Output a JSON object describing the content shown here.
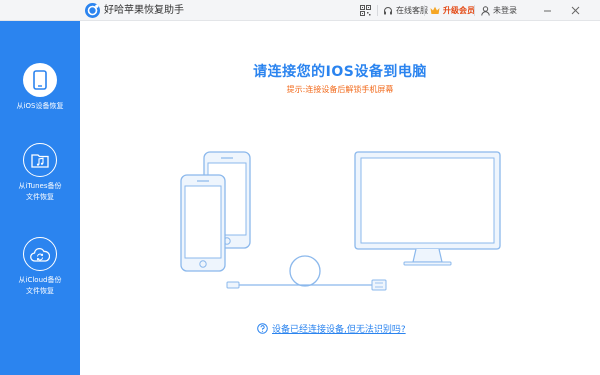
{
  "window": {
    "title": "好哈苹果恢复助手"
  },
  "toolbar": {
    "service_label": "在线客服",
    "vip_label": "升级会员",
    "login_label": "未登录"
  },
  "sidebar": {
    "items": [
      {
        "label": "从iOS设备恢复",
        "icon": "phone-icon",
        "active": true
      },
      {
        "label": "从iTunes备份\n文件恢复",
        "icon": "music-folder-icon",
        "active": false
      },
      {
        "label": "从iCloud备份\n文件恢复",
        "icon": "cloud-sync-icon",
        "active": false
      }
    ]
  },
  "main": {
    "headline": "请连接您的IOS设备到电脑",
    "subline": "提示:连接设备后解锁手机屏幕",
    "help_link": "设备已经连接设备,但无法识别吗?"
  },
  "colors": {
    "accent": "#2b84ef",
    "warning": "#f26b1d",
    "vip": "#e34b17",
    "illustration_fill": "#eef5fd",
    "illustration_stroke": "#8bb8ec"
  }
}
